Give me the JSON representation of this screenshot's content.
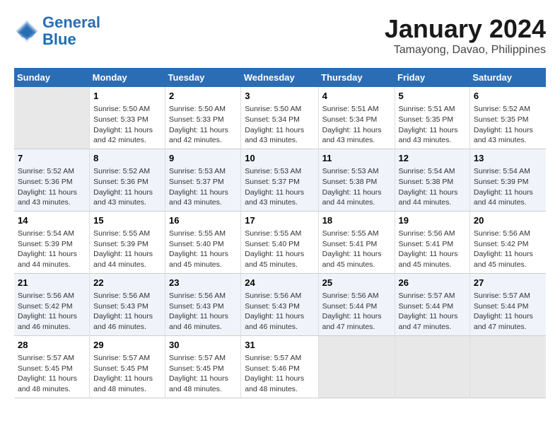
{
  "header": {
    "logo_line1": "General",
    "logo_line2": "Blue",
    "month_year": "January 2024",
    "location": "Tamayong, Davao, Philippines"
  },
  "columns": [
    "Sunday",
    "Monday",
    "Tuesday",
    "Wednesday",
    "Thursday",
    "Friday",
    "Saturday"
  ],
  "weeks": [
    [
      {
        "day": "",
        "detail": ""
      },
      {
        "day": "1",
        "detail": "Sunrise: 5:50 AM\nSunset: 5:33 PM\nDaylight: 11 hours\nand 42 minutes."
      },
      {
        "day": "2",
        "detail": "Sunrise: 5:50 AM\nSunset: 5:33 PM\nDaylight: 11 hours\nand 42 minutes."
      },
      {
        "day": "3",
        "detail": "Sunrise: 5:50 AM\nSunset: 5:34 PM\nDaylight: 11 hours\nand 43 minutes."
      },
      {
        "day": "4",
        "detail": "Sunrise: 5:51 AM\nSunset: 5:34 PM\nDaylight: 11 hours\nand 43 minutes."
      },
      {
        "day": "5",
        "detail": "Sunrise: 5:51 AM\nSunset: 5:35 PM\nDaylight: 11 hours\nand 43 minutes."
      },
      {
        "day": "6",
        "detail": "Sunrise: 5:52 AM\nSunset: 5:35 PM\nDaylight: 11 hours\nand 43 minutes."
      }
    ],
    [
      {
        "day": "7",
        "detail": "Sunrise: 5:52 AM\nSunset: 5:36 PM\nDaylight: 11 hours\nand 43 minutes."
      },
      {
        "day": "8",
        "detail": "Sunrise: 5:52 AM\nSunset: 5:36 PM\nDaylight: 11 hours\nand 43 minutes."
      },
      {
        "day": "9",
        "detail": "Sunrise: 5:53 AM\nSunset: 5:37 PM\nDaylight: 11 hours\nand 43 minutes."
      },
      {
        "day": "10",
        "detail": "Sunrise: 5:53 AM\nSunset: 5:37 PM\nDaylight: 11 hours\nand 43 minutes."
      },
      {
        "day": "11",
        "detail": "Sunrise: 5:53 AM\nSunset: 5:38 PM\nDaylight: 11 hours\nand 44 minutes."
      },
      {
        "day": "12",
        "detail": "Sunrise: 5:54 AM\nSunset: 5:38 PM\nDaylight: 11 hours\nand 44 minutes."
      },
      {
        "day": "13",
        "detail": "Sunrise: 5:54 AM\nSunset: 5:39 PM\nDaylight: 11 hours\nand 44 minutes."
      }
    ],
    [
      {
        "day": "14",
        "detail": "Sunrise: 5:54 AM\nSunset: 5:39 PM\nDaylight: 11 hours\nand 44 minutes."
      },
      {
        "day": "15",
        "detail": "Sunrise: 5:55 AM\nSunset: 5:39 PM\nDaylight: 11 hours\nand 44 minutes."
      },
      {
        "day": "16",
        "detail": "Sunrise: 5:55 AM\nSunset: 5:40 PM\nDaylight: 11 hours\nand 45 minutes."
      },
      {
        "day": "17",
        "detail": "Sunrise: 5:55 AM\nSunset: 5:40 PM\nDaylight: 11 hours\nand 45 minutes."
      },
      {
        "day": "18",
        "detail": "Sunrise: 5:55 AM\nSunset: 5:41 PM\nDaylight: 11 hours\nand 45 minutes."
      },
      {
        "day": "19",
        "detail": "Sunrise: 5:56 AM\nSunset: 5:41 PM\nDaylight: 11 hours\nand 45 minutes."
      },
      {
        "day": "20",
        "detail": "Sunrise: 5:56 AM\nSunset: 5:42 PM\nDaylight: 11 hours\nand 45 minutes."
      }
    ],
    [
      {
        "day": "21",
        "detail": "Sunrise: 5:56 AM\nSunset: 5:42 PM\nDaylight: 11 hours\nand 46 minutes."
      },
      {
        "day": "22",
        "detail": "Sunrise: 5:56 AM\nSunset: 5:43 PM\nDaylight: 11 hours\nand 46 minutes."
      },
      {
        "day": "23",
        "detail": "Sunrise: 5:56 AM\nSunset: 5:43 PM\nDaylight: 11 hours\nand 46 minutes."
      },
      {
        "day": "24",
        "detail": "Sunrise: 5:56 AM\nSunset: 5:43 PM\nDaylight: 11 hours\nand 46 minutes."
      },
      {
        "day": "25",
        "detail": "Sunrise: 5:56 AM\nSunset: 5:44 PM\nDaylight: 11 hours\nand 47 minutes."
      },
      {
        "day": "26",
        "detail": "Sunrise: 5:57 AM\nSunset: 5:44 PM\nDaylight: 11 hours\nand 47 minutes."
      },
      {
        "day": "27",
        "detail": "Sunrise: 5:57 AM\nSunset: 5:44 PM\nDaylight: 11 hours\nand 47 minutes."
      }
    ],
    [
      {
        "day": "28",
        "detail": "Sunrise: 5:57 AM\nSunset: 5:45 PM\nDaylight: 11 hours\nand 48 minutes."
      },
      {
        "day": "29",
        "detail": "Sunrise: 5:57 AM\nSunset: 5:45 PM\nDaylight: 11 hours\nand 48 minutes."
      },
      {
        "day": "30",
        "detail": "Sunrise: 5:57 AM\nSunset: 5:45 PM\nDaylight: 11 hours\nand 48 minutes."
      },
      {
        "day": "31",
        "detail": "Sunrise: 5:57 AM\nSunset: 5:46 PM\nDaylight: 11 hours\nand 48 minutes."
      },
      {
        "day": "",
        "detail": ""
      },
      {
        "day": "",
        "detail": ""
      },
      {
        "day": "",
        "detail": ""
      }
    ]
  ]
}
